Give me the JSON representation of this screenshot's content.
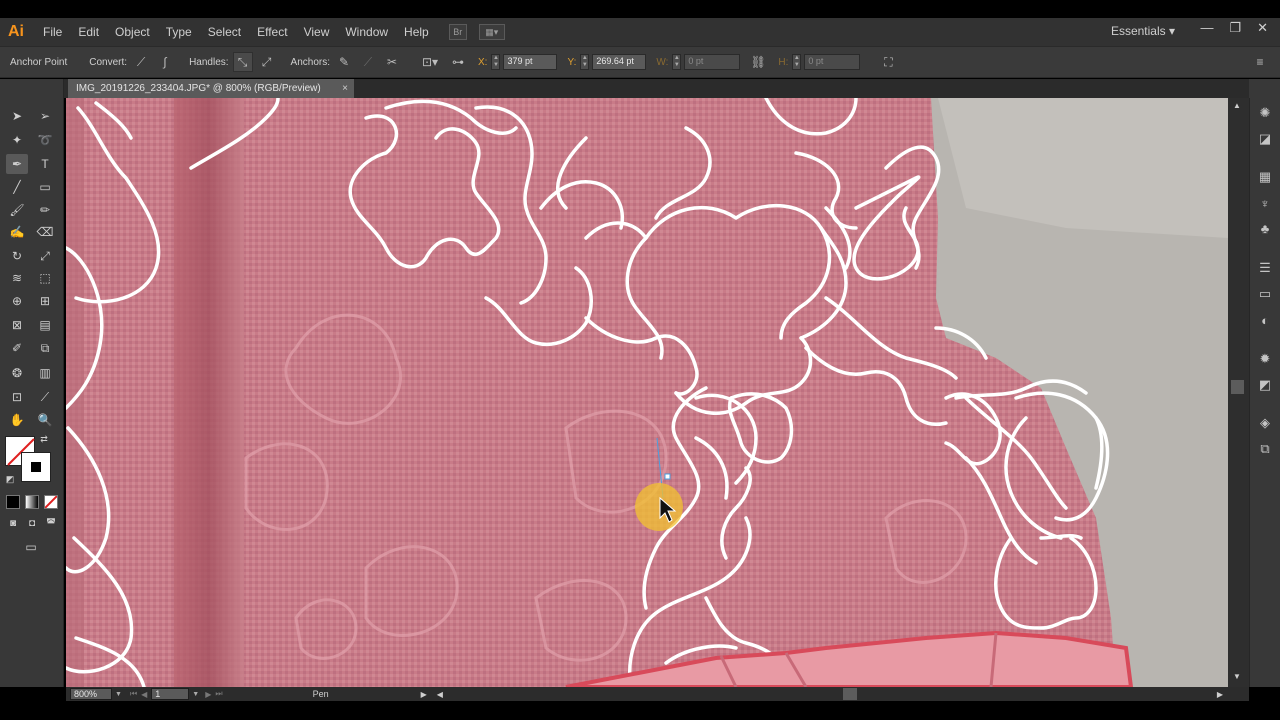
{
  "app": {
    "logo": "Ai",
    "menu": [
      "File",
      "Edit",
      "Object",
      "Type",
      "Select",
      "Effect",
      "View",
      "Window",
      "Help"
    ],
    "workspace": "Essentials",
    "window_controls": {
      "minimize": "—",
      "restore": "❐",
      "close": "✕"
    }
  },
  "control_bar": {
    "tool_name": "Anchor Point",
    "convert_label": "Convert:",
    "handles_label": "Handles:",
    "anchors_label": "Anchors:",
    "x_label": "X:",
    "x_value": "379 pt",
    "y_label": "Y:",
    "y_value": "269.64 pt",
    "w_label": "W:",
    "w_value": "0 pt",
    "h_label": "H:",
    "h_value": "0 pt"
  },
  "document": {
    "tab_title": "IMG_20191226_233404.JPG* @ 800% (RGB/Preview)",
    "tab_close": "×"
  },
  "status_bar": {
    "zoom": "800%",
    "artboard": "1",
    "current_tool": "Pen"
  },
  "colors": {
    "fabric": "#c97b88",
    "outline": "#ffffff",
    "cursor_highlight": "#f2c230",
    "background_wall": "#b8b5b0"
  },
  "icons": {
    "selection": "arrow-icon",
    "pen": "pen-icon",
    "type": "type-icon"
  }
}
